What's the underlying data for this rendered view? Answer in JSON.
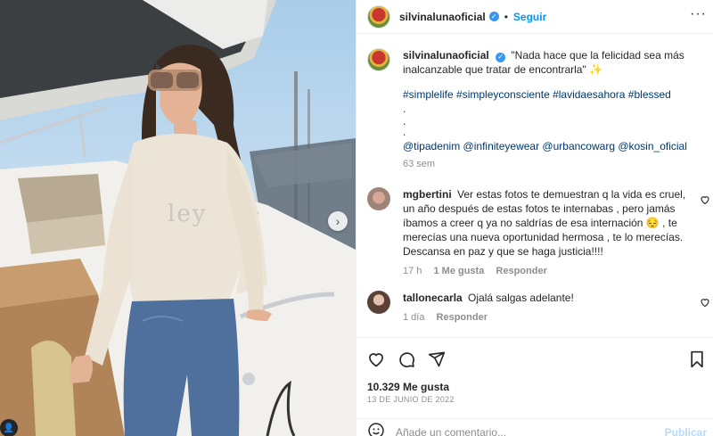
{
  "post": {
    "username": "silvinalunaoficial",
    "follow_label": "Seguir",
    "dot": "•",
    "more_label": "···",
    "verified_mark": "✓"
  },
  "caption": {
    "username": "silvinalunaoficial",
    "text": "\"Nada hace que la felicidad sea más inalcanzable que tratar de encontrarla\" ✨",
    "hashtags": "#simplelife #simpleyconsciente #lavidaesahora #blessed",
    "dots": [
      ".",
      ".",
      "."
    ],
    "mentions": "@tipadenim @infiniteyewear @urbancowarg @kosin_oficial",
    "time": "63 sem"
  },
  "comments": [
    {
      "username": "mgbertini",
      "text": "Ver estas fotos te demuestran q la vida es cruel, un año después de estas fotos te internabas , pero jamás íbamos a creer q ya no saldrías de esa internación 😔 , te merecías una nueva oportunidad hermosa , te lo merecías. Descansa en paz y que se haga justicia!!!!",
      "time": "17 h",
      "likes": "1 Me gusta",
      "reply": "Responder"
    },
    {
      "username": "tallonecarla",
      "text": "Ojalá salgas adelante!",
      "time": "1 día",
      "reply": "Responder"
    }
  ],
  "actions": {
    "likes": "10.329 Me gusta",
    "date": "13 DE JUNIO DE 2022"
  },
  "composer": {
    "placeholder": "Añade un comentario...",
    "publish_label": "Publicar"
  },
  "photo": {
    "next_label": "›",
    "tag_label": "👤",
    "sweater_text": "ley"
  },
  "colors": {
    "accent": "#0095f6",
    "link": "#00376b",
    "muted": "#8e8e8e",
    "publish_disabled": "#b3dbff"
  }
}
